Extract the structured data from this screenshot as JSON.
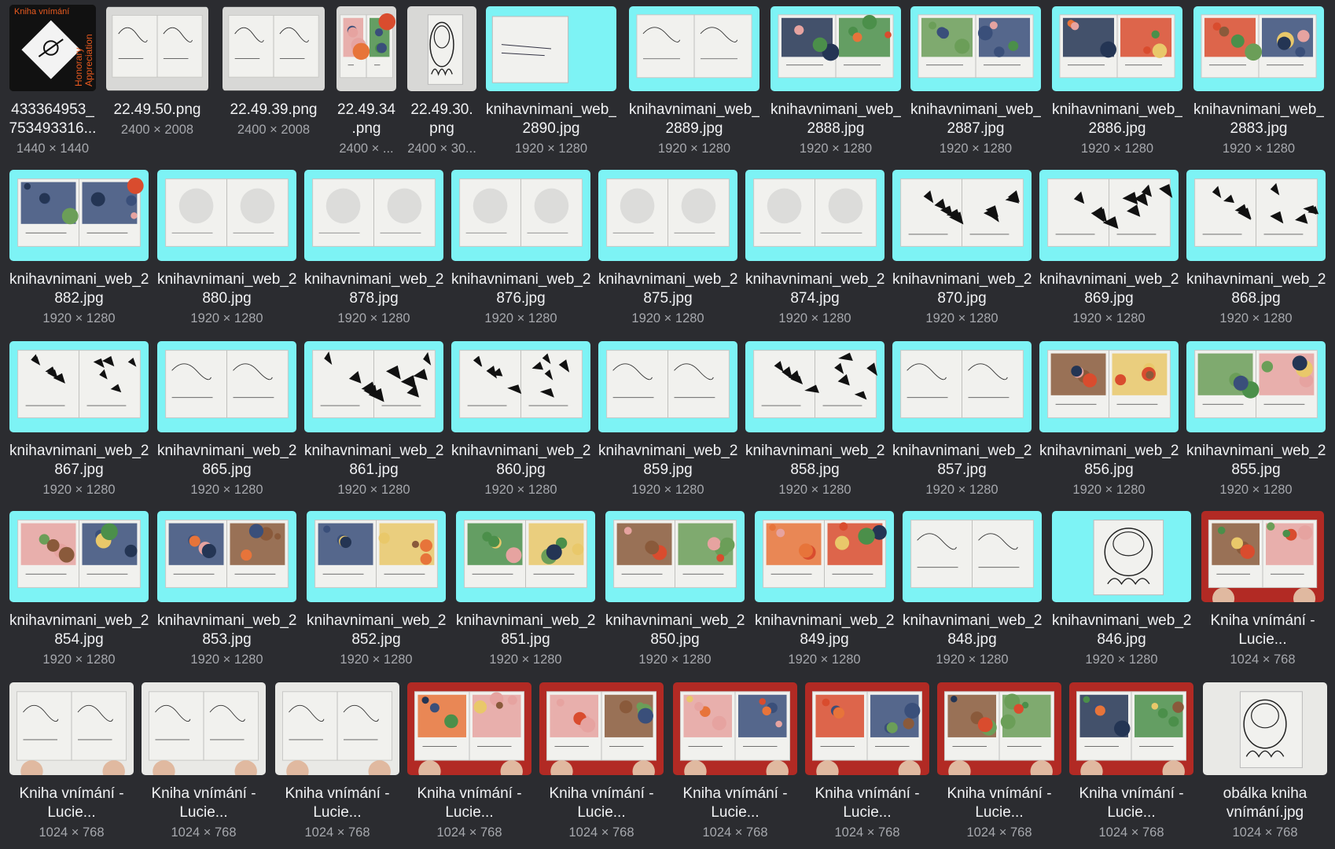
{
  "colors": {
    "background": "#2b2c30",
    "filename": "#f1f2f4",
    "dimensions": "#a6a8ad",
    "cyan_backdrop": "#7df3f5",
    "book_page": "#eeeeec",
    "red_rug": "#b22a24",
    "cover_orange": "#e85a1f"
  },
  "cover_text": {
    "title": "Kniha vnímání",
    "side": "Honorary Appreciation"
  },
  "overlay_badge": "",
  "rows": [
    [
      {
        "name": "433364953_\n753493316...",
        "dims": "1440 × 1440",
        "kind": "cover"
      },
      {
        "name": "22.49.50.png",
        "dims": "2400 × 2008",
        "kind": "scan"
      },
      {
        "name": "22.49.39.png",
        "dims": "2400 × 2008",
        "kind": "scan"
      },
      {
        "name": "22.49.34\n.png",
        "dims": "2400 × ...",
        "kind": "scan-color"
      },
      {
        "name": "22.49.30.\npng",
        "dims": "2400 × 30...",
        "kind": "scan-face"
      },
      {
        "name": "knihavnimani_web_\n2890.jpg",
        "dims": "1920 × 1280",
        "kind": "cyan-closed"
      },
      {
        "name": "knihavnimani_web_\n2889.jpg",
        "dims": "1920 × 1280",
        "kind": "cyan-line"
      },
      {
        "name": "knihavnimani_web_\n2888.jpg",
        "dims": "1920 × 1280",
        "kind": "cyan-color"
      },
      {
        "name": "knihavnimani_web_\n2887.jpg",
        "dims": "1920 × 1280",
        "kind": "cyan-color"
      },
      {
        "name": "knihavnimani_web_\n2886.jpg",
        "dims": "1920 × 1280",
        "kind": "cyan-color"
      },
      {
        "name": "knihavnimani_web_\n2883.jpg",
        "dims": "1920 × 1280",
        "kind": "cyan-color"
      }
    ],
    [
      {
        "name": "knihavnimani_web_2\n882.jpg",
        "dims": "1920 × 1280",
        "kind": "cyan-color"
      },
      {
        "name": "knihavnimani_web_2\n880.jpg",
        "dims": "1920 × 1280",
        "kind": "cyan-grey"
      },
      {
        "name": "knihavnimani_web_2\n878.jpg",
        "dims": "1920 × 1280",
        "kind": "cyan-grey"
      },
      {
        "name": "knihavnimani_web_2\n876.jpg",
        "dims": "1920 × 1280",
        "kind": "cyan-grey"
      },
      {
        "name": "knihavnimani_web_2\n875.jpg",
        "dims": "1920 × 1280",
        "kind": "cyan-grey"
      },
      {
        "name": "knihavnimani_web_2\n874.jpg",
        "dims": "1920 × 1280",
        "kind": "cyan-grey"
      },
      {
        "name": "knihavnimani_web_2\n870.jpg",
        "dims": "1920 × 1280",
        "kind": "cyan-ink"
      },
      {
        "name": "knihavnimani_web_2\n869.jpg",
        "dims": "1920 × 1280",
        "kind": "cyan-ink"
      },
      {
        "name": "knihavnimani_web_2\n868.jpg",
        "dims": "1920 × 1280",
        "kind": "cyan-ink"
      }
    ],
    [
      {
        "name": "knihavnimani_web_2\n867.jpg",
        "dims": "1920 × 1280",
        "kind": "cyan-ink"
      },
      {
        "name": "knihavnimani_web_2\n865.jpg",
        "dims": "1920 × 1280",
        "kind": "cyan-line"
      },
      {
        "name": "knihavnimani_web_2\n861.jpg",
        "dims": "1920 × 1280",
        "kind": "cyan-ink"
      },
      {
        "name": "knihavnimani_web_2\n860.jpg",
        "dims": "1920 × 1280",
        "kind": "cyan-ink"
      },
      {
        "name": "knihavnimani_web_2\n859.jpg",
        "dims": "1920 × 1280",
        "kind": "cyan-line"
      },
      {
        "name": "knihavnimani_web_2\n858.jpg",
        "dims": "1920 × 1280",
        "kind": "cyan-ink"
      },
      {
        "name": "knihavnimani_web_2\n857.jpg",
        "dims": "1920 × 1280",
        "kind": "cyan-line"
      },
      {
        "name": "knihavnimani_web_2\n856.jpg",
        "dims": "1920 × 1280",
        "kind": "cyan-color"
      },
      {
        "name": "knihavnimani_web_2\n855.jpg",
        "dims": "1920 × 1280",
        "kind": "cyan-color"
      }
    ],
    [
      {
        "name": "knihavnimani_web_2\n854.jpg",
        "dims": "1920 × 1280",
        "kind": "cyan-color"
      },
      {
        "name": "knihavnimani_web_2\n853.jpg",
        "dims": "1920 × 1280",
        "kind": "cyan-color"
      },
      {
        "name": "knihavnimani_web_2\n852.jpg",
        "dims": "1920 × 1280",
        "kind": "cyan-color"
      },
      {
        "name": "knihavnimani_web_2\n851.jpg",
        "dims": "1920 × 1280",
        "kind": "cyan-color"
      },
      {
        "name": "knihavnimani_web_2\n850.jpg",
        "dims": "1920 × 1280",
        "kind": "cyan-color"
      },
      {
        "name": "knihavnimani_web_2\n849.jpg",
        "dims": "1920 × 1280",
        "kind": "cyan-color"
      },
      {
        "name": "knihavnimani_web_2\n848.jpg",
        "dims": "1920 × 1280",
        "kind": "cyan-line"
      },
      {
        "name": "knihavnimani_web_2\n846.jpg",
        "dims": "1920 × 1280",
        "kind": "cyan-closed-face"
      },
      {
        "name": "Kniha vnímání -\nLucie...",
        "dims": "1024 × 768",
        "kind": "photo-rug"
      }
    ],
    [
      {
        "name": "Kniha vnímání -\nLucie...",
        "dims": "1024 × 768",
        "kind": "photo-white"
      },
      {
        "name": "Kniha vnímání -\nLucie...",
        "dims": "1024 × 768",
        "kind": "photo-white"
      },
      {
        "name": "Kniha vnímání -\nLucie...",
        "dims": "1024 × 768",
        "kind": "photo-white"
      },
      {
        "name": "Kniha vnímání -\nLucie...",
        "dims": "1024 × 768",
        "kind": "photo-rug"
      },
      {
        "name": "Kniha vnímání -\nLucie...",
        "dims": "1024 × 768",
        "kind": "photo-rug"
      },
      {
        "name": "Kniha vnímání -\nLucie...",
        "dims": "1024 × 768",
        "kind": "photo-rug"
      },
      {
        "name": "Kniha vnímání -\nLucie...",
        "dims": "1024 × 768",
        "kind": "photo-rug"
      },
      {
        "name": "Kniha vnímání -\nLucie...",
        "dims": "1024 × 768",
        "kind": "photo-rug"
      },
      {
        "name": "Kniha vnímání -\nLucie...",
        "dims": "1024 × 768",
        "kind": "photo-rug"
      },
      {
        "name": "obálka kniha\nvnímání.jpg",
        "dims": "1024 × 768",
        "kind": "photo-face"
      }
    ]
  ]
}
